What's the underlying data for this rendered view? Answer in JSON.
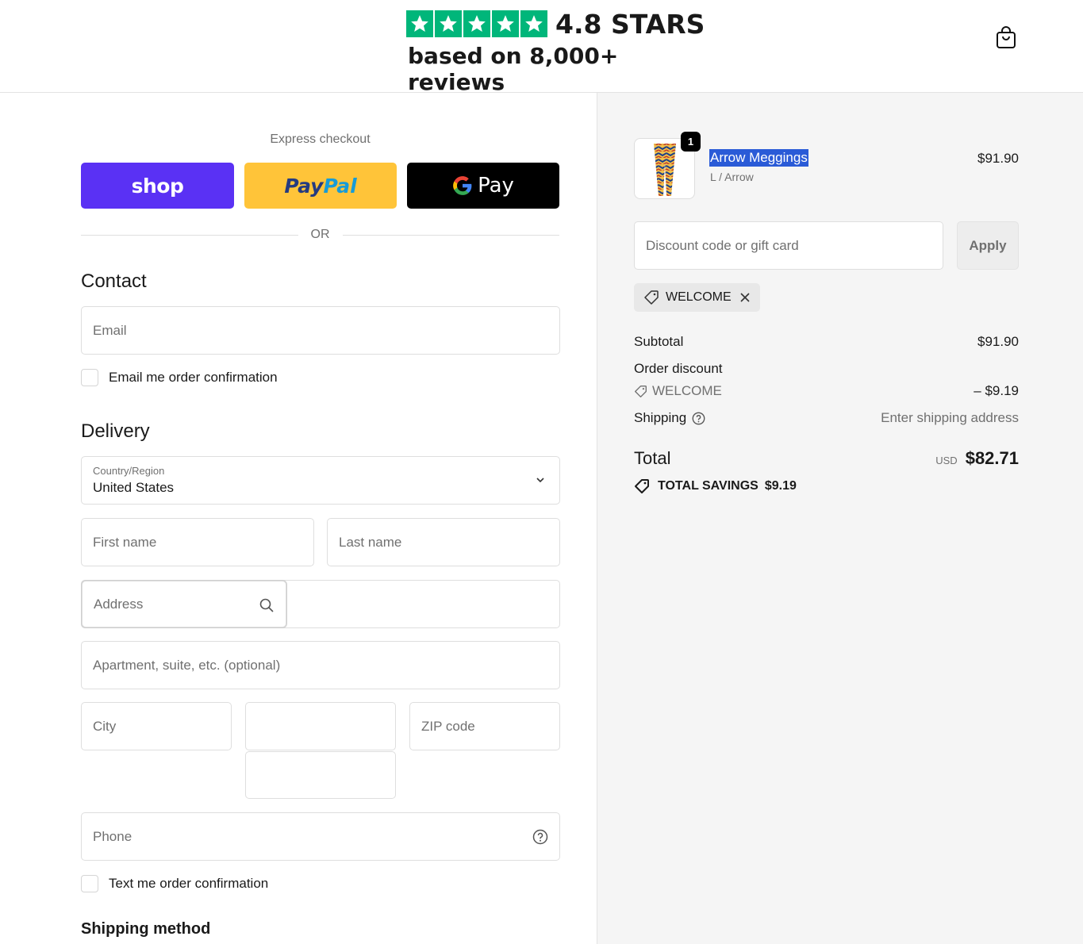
{
  "header": {
    "rating_text": "4.8 STARS",
    "reviews_text": "based on 8,000+ reviews",
    "star_count": 5,
    "star_color": "#00b67a",
    "cart_icon": "shopping-bag-icon"
  },
  "express": {
    "label": "Express checkout",
    "shop_label": "shop",
    "paypal_part1": "Pay",
    "paypal_part2": "Pal",
    "gpay_g": "G",
    "gpay_label": "Pay",
    "or_label": "OR"
  },
  "contact": {
    "title": "Contact",
    "email_placeholder": "Email",
    "email_optin": "Email me order confirmation"
  },
  "delivery": {
    "title": "Delivery",
    "country_label": "Country/Region",
    "country_value": "United States",
    "first_name_placeholder": "First name",
    "last_name_placeholder": "Last name",
    "address_placeholder": "Address",
    "apartment_placeholder": "Apartment, suite, etc. (optional)",
    "city_placeholder": "City",
    "zip_placeholder": "ZIP code",
    "phone_placeholder": "Phone",
    "sms_optin": "Text me order confirmation"
  },
  "shipping_method": {
    "title": "Shipping method"
  },
  "order": {
    "item": {
      "quantity": "1",
      "name": "Arrow Meggings",
      "variant": "L / Arrow",
      "price": "$91.90"
    },
    "discount_placeholder": "Discount code or gift card",
    "apply_label": "Apply",
    "applied_code": "WELCOME",
    "subtotal_label": "Subtotal",
    "subtotal_value": "$91.90",
    "order_discount_label": "Order discount",
    "discount_code": "WELCOME",
    "discount_value": "– $9.19",
    "shipping_label": "Shipping",
    "shipping_value": "Enter shipping address",
    "total_label": "Total",
    "currency": "USD",
    "total_value": "$82.71",
    "savings_label": "TOTAL SAVINGS",
    "savings_value": "$9.19"
  },
  "colors": {
    "shop_purple": "#5a31f4",
    "paypal_yellow": "#ffc439",
    "gpay_black": "#000000",
    "selection_blue": "#2a5bd7"
  }
}
